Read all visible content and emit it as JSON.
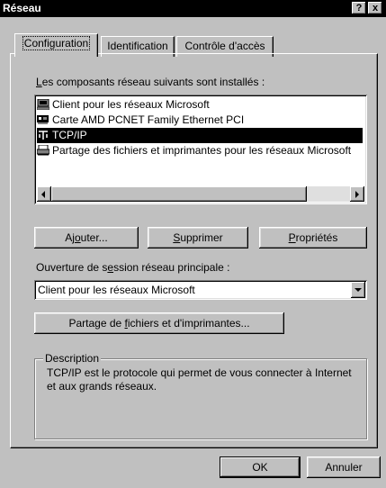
{
  "window": {
    "title": "Réseau",
    "help_btn": "?",
    "close_btn": "x"
  },
  "tabs": [
    {
      "label": "Configuration",
      "active": true
    },
    {
      "label": "Identification",
      "active": false
    },
    {
      "label": "Contrôle d'accès",
      "active": false
    }
  ],
  "components": {
    "label_prefix": "L",
    "label_rest": "es composants réseau suivants sont installés :",
    "items": [
      {
        "label": "Client pour les réseaux Microsoft",
        "icon": "network-client-icon",
        "selected": false
      },
      {
        "label": "Carte AMD PCNET Family Ethernet PCI",
        "icon": "network-card-icon",
        "selected": false
      },
      {
        "label": "TCP/IP",
        "icon": "protocol-icon",
        "selected": true
      },
      {
        "label": "Partage des fichiers et imprimantes pour les réseaux Microsoft",
        "icon": "file-print-sharing-icon",
        "selected": false
      }
    ]
  },
  "buttons": {
    "add_pre": "Aj",
    "add_u": "o",
    "add_post": "uter...",
    "remove_u": "S",
    "remove_post": "upprimer",
    "props_u": "P",
    "props_post": "ropriétés",
    "share_pre": "Partage de ",
    "share_u": "f",
    "share_post": "ichiers et d'imprimantes...",
    "ok": "OK",
    "cancel": "Annuler"
  },
  "logon": {
    "label_pre": "Ouverture de s",
    "label_u": "e",
    "label_post": "ssion réseau principale :",
    "value": "Client pour les réseaux Microsoft"
  },
  "description": {
    "title": "Description",
    "text": "TCP/IP est le protocole qui permet de vous connecter à Internet et aux grands réseaux."
  }
}
